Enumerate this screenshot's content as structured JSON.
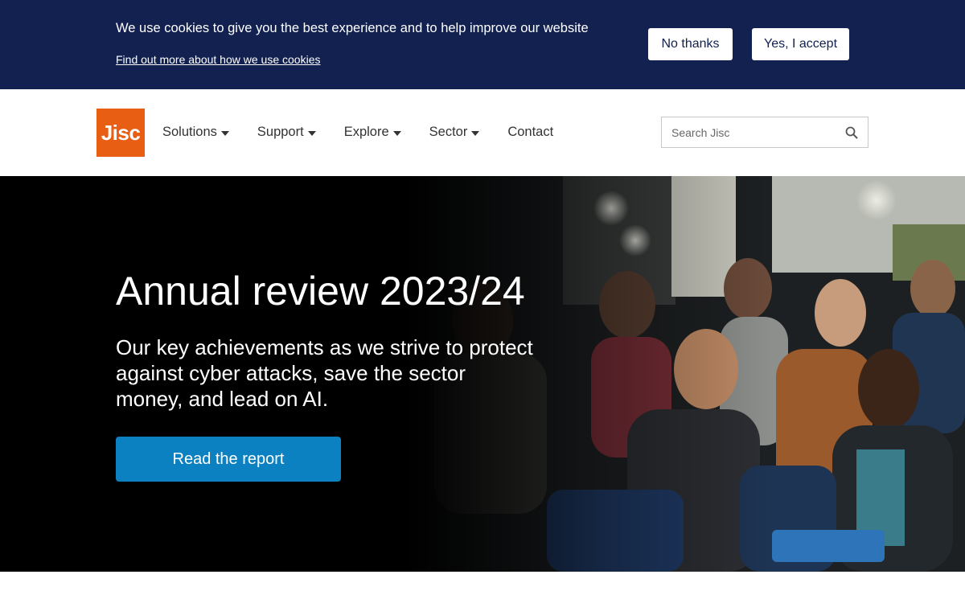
{
  "cookie_banner": {
    "message": "We use cookies to give you the best experience and to help improve our website",
    "link_text": "Find out more about how we use cookies",
    "decline_label": "No thanks",
    "accept_label": "Yes, I accept"
  },
  "header": {
    "logo_text": "Jisc",
    "logo_color": "#e85e13",
    "nav": [
      {
        "label": "Solutions",
        "has_dropdown": true
      },
      {
        "label": "Support",
        "has_dropdown": true
      },
      {
        "label": "Explore",
        "has_dropdown": true
      },
      {
        "label": "Sector",
        "has_dropdown": true
      },
      {
        "label": "Contact",
        "has_dropdown": false
      }
    ],
    "search_placeholder": "Search Jisc",
    "search_icon": "search-icon"
  },
  "hero": {
    "title": "Annual review 2023/24",
    "subtitle": "Our key achievements as we strive to protect against cyber attacks, save the sector money, and lead on AI.",
    "cta_label": "Read the report",
    "cta_color": "#0b81c2"
  },
  "colors": {
    "banner_bg": "#12214f",
    "brand_orange": "#e85e13",
    "cta_blue": "#0b81c2"
  }
}
